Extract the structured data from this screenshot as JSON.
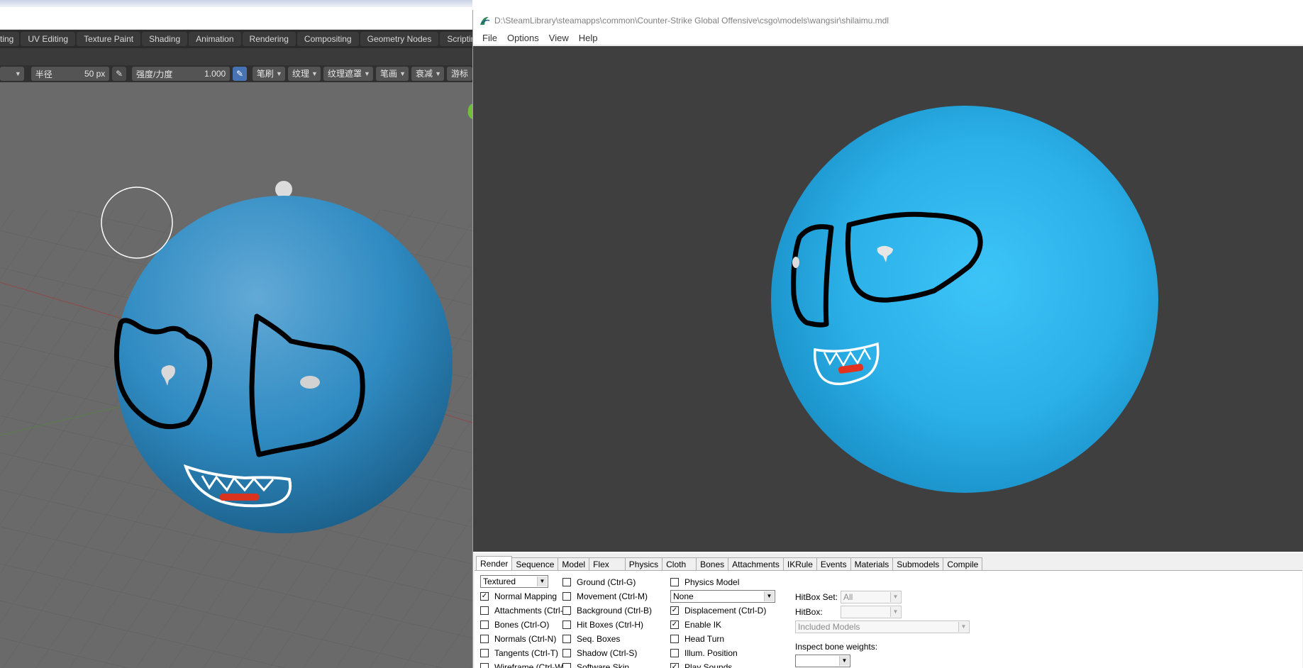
{
  "blender": {
    "workspace_tabs": [
      "ting",
      "UV Editing",
      "Texture Paint",
      "Shading",
      "Animation",
      "Rendering",
      "Compositing",
      "Geometry Nodes",
      "Scripting"
    ],
    "add_tab": "+",
    "toolbar": {
      "radius_label": "半径",
      "radius_value": "50 px",
      "strength_label": "强度/力度",
      "strength_value": "1.000",
      "dropdowns": [
        "笔刷",
        "纹理",
        "纹理遮罩",
        "笔画",
        "衰减",
        "游标"
      ]
    },
    "sphere_color": "#3a96c9"
  },
  "hlmv": {
    "title": "D:\\SteamLibrary\\steamapps\\common\\Counter-Strike Global Offensive\\csgo\\models\\wangsir\\shilaimu.mdl",
    "menu": [
      "File",
      "Options",
      "View",
      "Help"
    ],
    "viewport_bg": "#3f3f3f",
    "sphere_color": "#2bb0e8",
    "tabs": [
      "Render",
      "Sequence",
      "Model",
      "Flex",
      "Physics",
      "Cloth",
      "Bones",
      "Attachments",
      "IKRule",
      "Events",
      "Materials",
      "Submodels",
      "Compile"
    ],
    "active_tab": "Render",
    "render_mode": "Textured",
    "col1": [
      {
        "label": "Normal Mapping",
        "checked": true
      },
      {
        "label": "Attachments (Ctrl-A)",
        "checked": false
      },
      {
        "label": "Bones (Ctrl-O)",
        "checked": false
      },
      {
        "label": "Normals (Ctrl-N)",
        "checked": false
      },
      {
        "label": "Tangents (Ctrl-T)",
        "checked": false
      },
      {
        "label": "Wireframe (Ctrl-W)",
        "checked": false
      }
    ],
    "col2": [
      {
        "label": "Ground (Ctrl-G)",
        "checked": false
      },
      {
        "label": "Movement (Ctrl-M)",
        "checked": false
      },
      {
        "label": "Background (Ctrl-B)",
        "checked": false
      },
      {
        "label": "Hit Boxes (Ctrl-H)",
        "checked": false
      },
      {
        "label": "Seq. Boxes",
        "checked": false
      },
      {
        "label": "Shadow (Ctrl-S)",
        "checked": false
      },
      {
        "label": "Software Skin",
        "checked": false
      }
    ],
    "col3": [
      {
        "label": "Physics Model",
        "checked": false
      },
      {
        "label": "Displacement (Ctrl-D)",
        "checked": true
      },
      {
        "label": "Enable IK",
        "checked": true
      },
      {
        "label": "Head Turn",
        "checked": false
      },
      {
        "label": "Illum. Position",
        "checked": false
      },
      {
        "label": "Play Sounds",
        "checked": true
      }
    ],
    "physics_select": "None",
    "hitbox_set_label": "HitBox Set:",
    "hitbox_set_value": "All",
    "hitbox_label": "HitBox:",
    "hitbox_value": "",
    "included_models": "Included Models",
    "inspect_label": "Inspect bone weights:",
    "inspect_value": ""
  }
}
